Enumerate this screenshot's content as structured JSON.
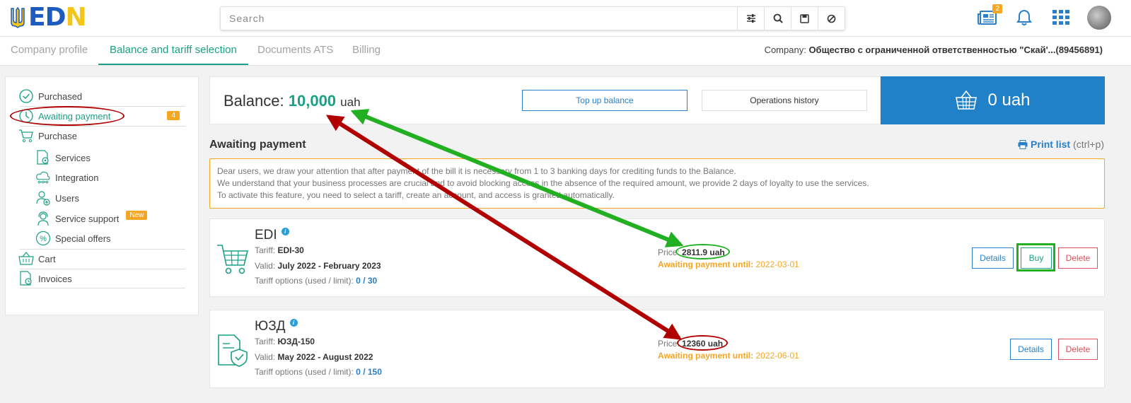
{
  "header": {
    "logo_text_a": "ED",
    "logo_text_b": "N",
    "search_placeholder": "Search",
    "news_badge": "2"
  },
  "tabs": [
    {
      "label": "Company profile",
      "active": false
    },
    {
      "label": "Balance and tariff selection",
      "active": true
    },
    {
      "label": "Documents ATS",
      "active": false
    },
    {
      "label": "Billing",
      "active": false
    }
  ],
  "company": {
    "label": "Company:",
    "name": "Общество с ограниченной ответственностью \"Скай'...(89456891)"
  },
  "sidebar": {
    "purchased": "Purchased",
    "awaiting": "Awaiting payment",
    "awaiting_count": "4",
    "purchase": "Purchase",
    "services": "Services",
    "integration": "Integration",
    "users": "Users",
    "service_support": "Service support",
    "new_badge": "New",
    "special_offers": "Special offers",
    "cart": "Cart",
    "invoices": "Invoices"
  },
  "balance": {
    "label": "Balance:",
    "amount": "10,000",
    "currency": "uah",
    "top_up": "Top up balance",
    "history": "Operations history",
    "cart_total": "0 uah"
  },
  "section": {
    "title": "Awaiting payment",
    "print": "Print list",
    "print_hint": "(ctrl+p)"
  },
  "notice": {
    "line1": "Dear users, we draw your attention that after payment of the bill it is necessary from 1 to 3 banking days for crediting funds to the Balance.",
    "line2": "We understand that your business processes are crucial and to avoid blocking access in the absence of the required amount, we provide 2 days of loyalty to use the services.",
    "line3": "To activate this feature, you need to select a tariff, create an account, and access is granted automatically."
  },
  "labels": {
    "tariff": "Tariff:",
    "valid": "Valid:",
    "options": "Tariff options (used / limit):",
    "price": "Price:",
    "await_until": "Awaiting payment until:",
    "details": "Details",
    "buy": "Buy",
    "delete": "Delete"
  },
  "cards": [
    {
      "title": "EDI",
      "tariff": "EDI-30",
      "valid": "July 2022 - February 2023",
      "used": "0",
      "limit": "/ 30",
      "price": "2811.9 uah",
      "until": "2022-03-01"
    },
    {
      "title": "ЮЗД",
      "tariff": "ЮЗД-150",
      "valid": "May 2022 - August 2022",
      "used": "0",
      "limit": "/ 150",
      "price": "12360 uah",
      "until": "2022-06-01"
    }
  ],
  "colors": {
    "accent": "#1aa086",
    "blue": "#2080c8",
    "orange": "#f5a623",
    "annotation_red": "#b00000",
    "annotation_green": "#22b022"
  }
}
